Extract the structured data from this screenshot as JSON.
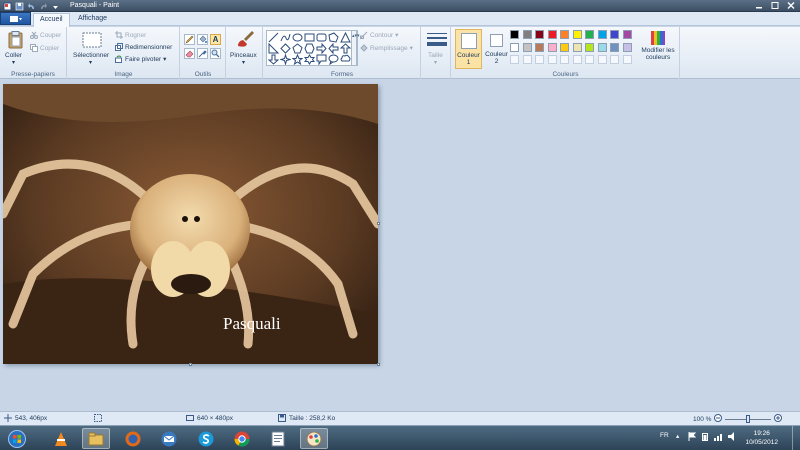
{
  "window": {
    "title": "Pasquali - Paint"
  },
  "tabs": {
    "file_icon": "paint-menu-icon",
    "home": "Accueil",
    "view": "Affichage"
  },
  "clipboard": {
    "paste": "Coller",
    "cut": "Couper",
    "copy": "Copier",
    "label": "Presse-papiers"
  },
  "image_group": {
    "select": "Sélectionner",
    "crop": "Rogner",
    "resize": "Redimensionner",
    "rotate": "Faire pivoter",
    "label": "Image"
  },
  "tools": {
    "label": "Outils",
    "items": [
      "pencil-icon",
      "fill-icon",
      "text-icon",
      "eraser-icon",
      "color-picker-icon",
      "magnifier-icon"
    ],
    "text_glyph": "A"
  },
  "brushes": {
    "label": "Pinceaux"
  },
  "shapes": {
    "label": "Formes",
    "outline": "Contour",
    "fill": "Remplissage"
  },
  "size": {
    "label": "Taille"
  },
  "colors": {
    "color1": "Couleur",
    "color1_num": "1",
    "color2": "Couleur",
    "color2_num": "2",
    "label": "Couleurs",
    "edit1": "Modifier les",
    "edit2": "couleurs",
    "palette_row1": [
      "#000000",
      "#7f7f7f",
      "#880015",
      "#ed1c24",
      "#ff7f27",
      "#fff200",
      "#22b14c",
      "#00a2e8",
      "#3f48cc",
      "#a349a4"
    ],
    "palette_row2": [
      "#ffffff",
      "#c3c3c3",
      "#b97a57",
      "#ffaec9",
      "#ffc90e",
      "#efe4b0",
      "#b5e61d",
      "#99d9ea",
      "#7092be",
      "#c8bfe7"
    ]
  },
  "canvas": {
    "caption": "Pasquali"
  },
  "status": {
    "cursor_pos": "543, 406px",
    "image_size": "640 × 480px",
    "file_size": "Taille : 258,2 Ko",
    "zoom": "100 %",
    "zoom_level": 0.5
  },
  "taskbar": {
    "lang": "FR",
    "time": "19:26",
    "date": "10/05/2012"
  }
}
